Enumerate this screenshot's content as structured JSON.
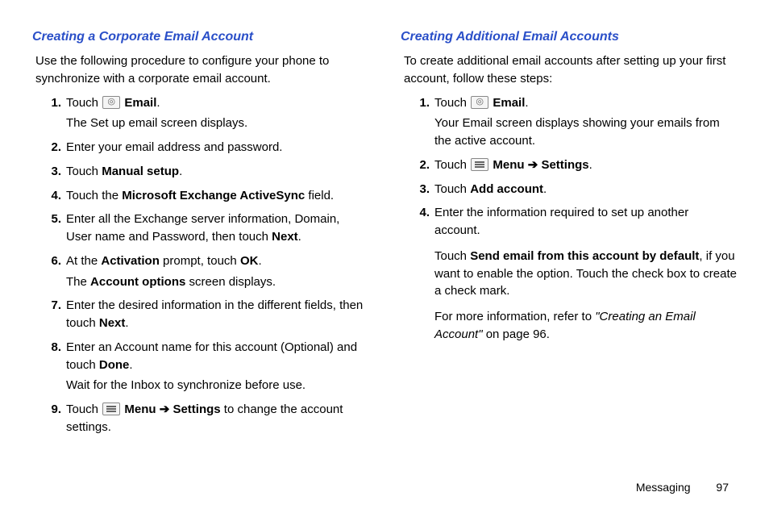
{
  "left": {
    "heading": "Creating a Corporate Email Account",
    "intro": "Use the following procedure to configure your phone to synchronize with a corporate email account.",
    "items": [
      {
        "num": "1.",
        "pre": "Touch ",
        "icon": "email",
        "post": " ",
        "bold": "Email",
        "tail": ".",
        "sub": "The Set up email screen displays."
      },
      {
        "num": "2.",
        "text": "Enter your email address and password."
      },
      {
        "num": "3.",
        "pre": "Touch ",
        "bold": "Manual setup",
        "tail": "."
      },
      {
        "num": "4.",
        "pre": "Touch the ",
        "bold": "Microsoft Exchange ActiveSync",
        "tail": " field."
      },
      {
        "num": "5.",
        "pre": "Enter all the Exchange server information, Domain, User name and Password, then touch ",
        "bold": "Next",
        "tail": "."
      },
      {
        "num": "6.",
        "pre": "At the ",
        "bold": "Activation",
        "mid": " prompt, touch ",
        "bold2": "OK",
        "tail": ".",
        "sub_pre": "The ",
        "sub_bold": "Account options",
        "sub_tail": " screen displays."
      },
      {
        "num": "7.",
        "pre": "Enter the desired information in the different fields, then touch ",
        "bold": "Next",
        "tail": "."
      },
      {
        "num": "8.",
        "pre": "Enter an Account name for this account (Optional) and touch ",
        "bold": "Done",
        "tail": ".",
        "sub": "Wait for the Inbox to synchronize before use."
      },
      {
        "num": "9.",
        "pre": "Touch ",
        "icon": "menu",
        "post": " ",
        "bold": "Menu",
        "arrow": " ➔ ",
        "bold2": "Settings",
        "tail": " to change the account settings."
      }
    ]
  },
  "right": {
    "heading": "Creating Additional Email Accounts",
    "intro": "To create additional email accounts after setting up your first account, follow these steps:",
    "items": [
      {
        "num": "1.",
        "pre": "Touch ",
        "icon": "email",
        "post": " ",
        "bold": "Email",
        "tail": ".",
        "sub": "Your Email screen displays showing your emails from the active account."
      },
      {
        "num": "2.",
        "pre": "Touch ",
        "icon": "menu",
        "post": " ",
        "bold": "Menu",
        "arrow": " ➔ ",
        "bold2": "Settings",
        "tail": "."
      },
      {
        "num": "3.",
        "pre": "Touch ",
        "bold": "Add account",
        "tail": "."
      },
      {
        "num": "4.",
        "text": "Enter the information required to set up another account.",
        "p2_pre": "Touch ",
        "p2_bold": "Send email from this account by default",
        "p2_tail": ", if you want to enable the option. Touch the check box to create a check mark.",
        "p3_pre": "For more information, refer to ",
        "p3_italic": "\"Creating an Email Account\"",
        "p3_tail": "  on page 96."
      }
    ]
  },
  "footer": {
    "section": "Messaging",
    "page": "97"
  }
}
